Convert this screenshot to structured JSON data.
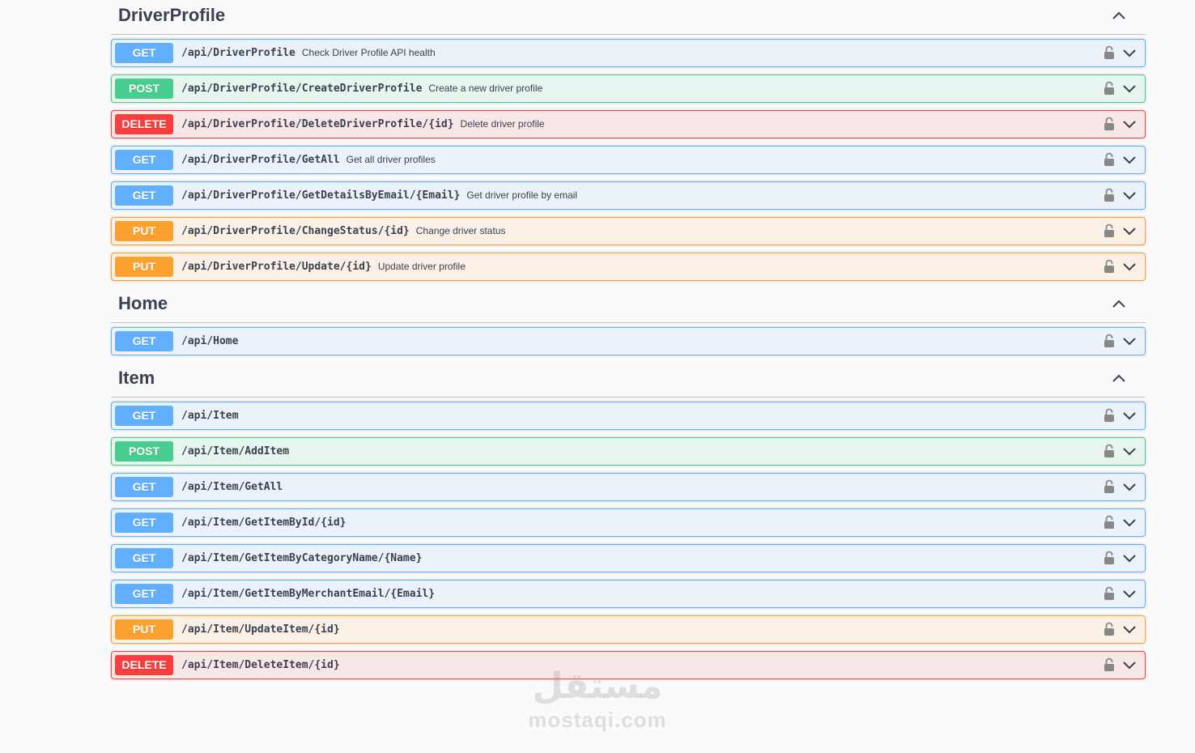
{
  "sections": [
    {
      "title": "DriverProfile",
      "operations": [
        {
          "method": "GET",
          "path": "/api/DriverProfile",
          "summary": "Check Driver Profile API health"
        },
        {
          "method": "POST",
          "path": "/api/DriverProfile/CreateDriverProfile",
          "summary": "Create a new driver profile"
        },
        {
          "method": "DELETE",
          "path": "/api/DriverProfile/DeleteDriverProfile/{id}",
          "summary": "Delete driver profile"
        },
        {
          "method": "GET",
          "path": "/api/DriverProfile/GetAll",
          "summary": "Get all driver profiles"
        },
        {
          "method": "GET",
          "path": "/api/DriverProfile/GetDetailsByEmail/{Email}",
          "summary": "Get driver profile by email"
        },
        {
          "method": "PUT",
          "path": "/api/DriverProfile/ChangeStatus/{id}",
          "summary": "Change driver status"
        },
        {
          "method": "PUT",
          "path": "/api/DriverProfile/Update/{id}",
          "summary": "Update driver profile"
        }
      ]
    },
    {
      "title": "Home",
      "operations": [
        {
          "method": "GET",
          "path": "/api/Home",
          "summary": ""
        }
      ]
    },
    {
      "title": "Item",
      "operations": [
        {
          "method": "GET",
          "path": "/api/Item",
          "summary": ""
        },
        {
          "method": "POST",
          "path": "/api/Item/AddItem",
          "summary": ""
        },
        {
          "method": "GET",
          "path": "/api/Item/GetAll",
          "summary": ""
        },
        {
          "method": "GET",
          "path": "/api/Item/GetItemById/{id}",
          "summary": ""
        },
        {
          "method": "GET",
          "path": "/api/Item/GetItemByCategoryName/{Name}",
          "summary": ""
        },
        {
          "method": "GET",
          "path": "/api/Item/GetItemByMerchantEmail/{Email}",
          "summary": ""
        },
        {
          "method": "PUT",
          "path": "/api/Item/UpdateItem/{id}",
          "summary": ""
        },
        {
          "method": "DELETE",
          "path": "/api/Item/DeleteItem/{id}",
          "summary": ""
        }
      ]
    }
  ],
  "watermark": {
    "arabic": "مستقل",
    "latin": "mostaqi.com"
  },
  "colors": {
    "get": "#61affe",
    "post": "#49cc90",
    "delete": "#f93e3e",
    "put": "#fca130"
  },
  "icons": {
    "section_toggle": "chevron-up-icon",
    "authorize": "lock-icon",
    "expand": "chevron-down-icon"
  }
}
